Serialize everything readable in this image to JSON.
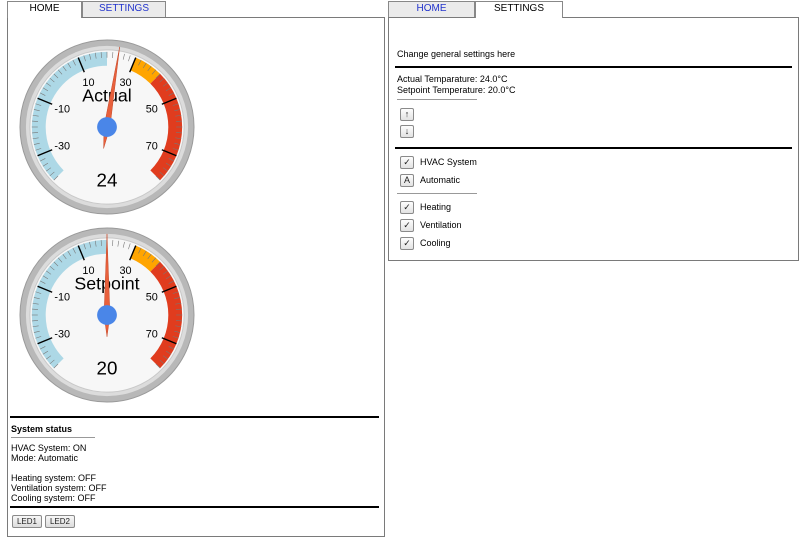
{
  "left_tabs": [
    {
      "label": "HOME",
      "active": true
    },
    {
      "label": "SETTINGS",
      "active": false
    }
  ],
  "right_tabs": [
    {
      "label": "HOME",
      "active": false
    },
    {
      "label": "SETTINGS",
      "active": true
    }
  ],
  "gauges": [
    {
      "label": "Actual",
      "value": 24,
      "value_text": "24",
      "min": -40,
      "max": 80,
      "ticks": [
        "-30",
        "-10",
        "10",
        "30",
        "50",
        "70"
      ]
    },
    {
      "label": "Setpoint",
      "value": 20,
      "value_text": "20",
      "min": -40,
      "max": 80,
      "ticks": [
        "-30",
        "-10",
        "10",
        "30",
        "50",
        "70"
      ]
    }
  ],
  "colors": {
    "cold": "#add8e6",
    "warm": "#ffa500",
    "hot": "#e03c1e",
    "needle": "#e8603c",
    "hub": "#4a86e8"
  },
  "status": {
    "title": "System status",
    "hvac": "HVAC System: ON",
    "mode": "Mode: Automatic",
    "heating": "Heating system: OFF",
    "ventilation": "Ventilation system: OFF",
    "cooling": "Cooling system: OFF"
  },
  "leds": [
    "LED1",
    "LED2"
  ],
  "settings": {
    "intro": "Change general settings here",
    "actual_temp": "Actual Temparature: 24.0°C",
    "setpoint_temp": "Setpoint Temperature: 20.0°C",
    "up_icon": "↑",
    "down_icon": "↓",
    "hvac_label": "HVAC System",
    "hvac_icon": "✓",
    "auto_label": "Automatic",
    "auto_icon": "A",
    "heating_label": "Heating",
    "heating_icon": "✓",
    "ventilation_label": "Ventilation",
    "ventilation_icon": "✓",
    "cooling_label": "Cooling",
    "cooling_icon": "✓"
  }
}
